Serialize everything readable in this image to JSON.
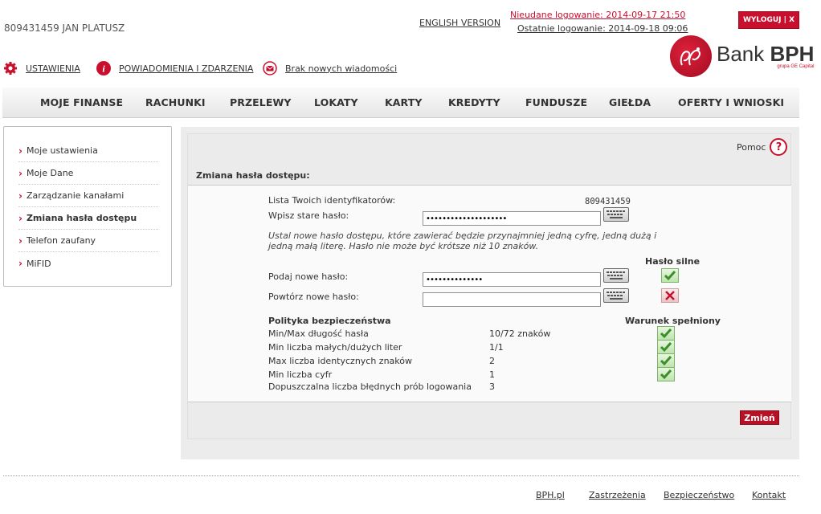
{
  "header": {
    "user_id": "809431459 JAN PLATUSZ",
    "english": "ENGLISH VERSION",
    "failed_login": "Nieudane logowanie: 2014-09-17 21:50",
    "last_login": "Ostatnie logowanie: 2014-09-18 09:06",
    "logout": "WYLOGUJ | X"
  },
  "utilities": {
    "settings": "USTAWIENIA",
    "notifications": "POWIADOMIENIA I ZDARZENIA",
    "messages": "Brak nowych wiadomości"
  },
  "logo": {
    "bank": "Bank",
    "bph": "BPH",
    "sub": "grupa GE Capital"
  },
  "nav": [
    "MOJE FINANSE",
    "RACHUNKI",
    "PRZELEWY",
    "LOKATY",
    "KARTY",
    "KREDYTY",
    "FUNDUSZE",
    "GIEŁDA",
    "OFERTY I WNIOSKI"
  ],
  "sidebar": {
    "items": [
      {
        "label": "Moje ustawienia"
      },
      {
        "label": "Moje Dane"
      },
      {
        "label": "Zarządzanie kanałami"
      },
      {
        "label": "Zmiana hasła dostępu"
      },
      {
        "label": "Telefon zaufany"
      },
      {
        "label": "MiFID"
      }
    ]
  },
  "main": {
    "help": "Pomoc",
    "title": "Zmiana hasła dostępu:",
    "ids_label": "Lista Twoich identyfikatorów:",
    "ids_value": "809431459",
    "old_label": "Wpisz stare hasło:",
    "old_value": "••••••••••••••••••••",
    "info_line1": "Ustal nowe hasło dostępu, które zawierać będzie przynajmniej jedną cyfrę, jedną dużą i",
    "info_line2": "jedną małą literę. Hasło nie może być krótsze niż 10 znaków.",
    "strength_label": "Hasło silne",
    "new_label": "Podaj nowe hasło:",
    "new_value": "••••••••••••••",
    "repeat_label": "Powtórz nowe hasło:",
    "repeat_value": "",
    "policy_title": "Polityka bezpieczeństwa",
    "condition_title": "Warunek spełniony",
    "policy": [
      {
        "name": "Min/Max długość hasła",
        "value": "10/72 znaków"
      },
      {
        "name": "Min liczba małych/dużych liter",
        "value": "1/1"
      },
      {
        "name": "Max liczba identycznych znaków",
        "value": "2"
      },
      {
        "name": "Min liczba cyfr",
        "value": "1"
      },
      {
        "name": "Dopuszczalna liczba błędnych prób logowania",
        "value": "3"
      }
    ],
    "submit": "Zmień"
  },
  "footer": [
    "BPH.pl",
    "Zastrzeżenia",
    "Bezpieczeństwo",
    "Kontakt"
  ],
  "colors": {
    "accent": "#c8102e",
    "nav_bg": "#ececec"
  }
}
